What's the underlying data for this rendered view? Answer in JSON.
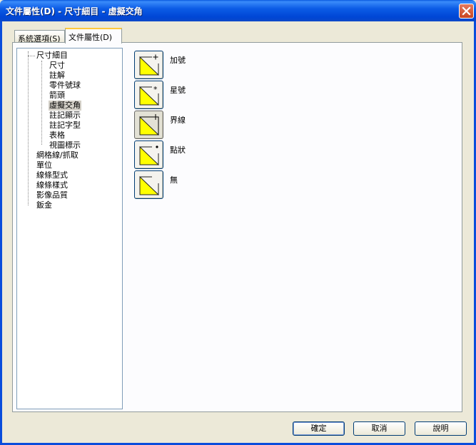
{
  "window": {
    "title": "文件屬性(D) - 尺寸細目 - 虛擬交角"
  },
  "tabs": [
    {
      "label": "系統選項(S)"
    },
    {
      "label": "文件屬性(D)"
    }
  ],
  "tree": {
    "items": [
      {
        "label": "尺寸細目"
      },
      {
        "label": "尺寸"
      },
      {
        "label": "註解"
      },
      {
        "label": "零件號球"
      },
      {
        "label": "箭頭"
      },
      {
        "label": "虛擬交角"
      },
      {
        "label": "註記顯示"
      },
      {
        "label": "註記字型"
      },
      {
        "label": "表格"
      },
      {
        "label": "視圖標示"
      },
      {
        "label": "網格線/抓取"
      },
      {
        "label": "單位"
      },
      {
        "label": "線條型式"
      },
      {
        "label": "線條樣式"
      },
      {
        "label": "影像品質"
      },
      {
        "label": "鈑金"
      }
    ],
    "selected": "虛擬交角"
  },
  "options": [
    {
      "label": "加號",
      "icon": "plus-corner-icon"
    },
    {
      "label": "星號",
      "icon": "star-corner-icon"
    },
    {
      "label": "界線",
      "icon": "witness-line-corner-icon"
    },
    {
      "label": "點狀",
      "icon": "dot-corner-icon"
    },
    {
      "label": "無",
      "icon": "no-marker-corner-icon"
    }
  ],
  "selected_option": "界線",
  "buttons": {
    "ok": "確定",
    "cancel": "取消",
    "help": "說明"
  },
  "colors": {
    "title_bar": "#0054e3",
    "icon_fill": "#ffff00",
    "tab_highlight": "#ffc83c"
  }
}
